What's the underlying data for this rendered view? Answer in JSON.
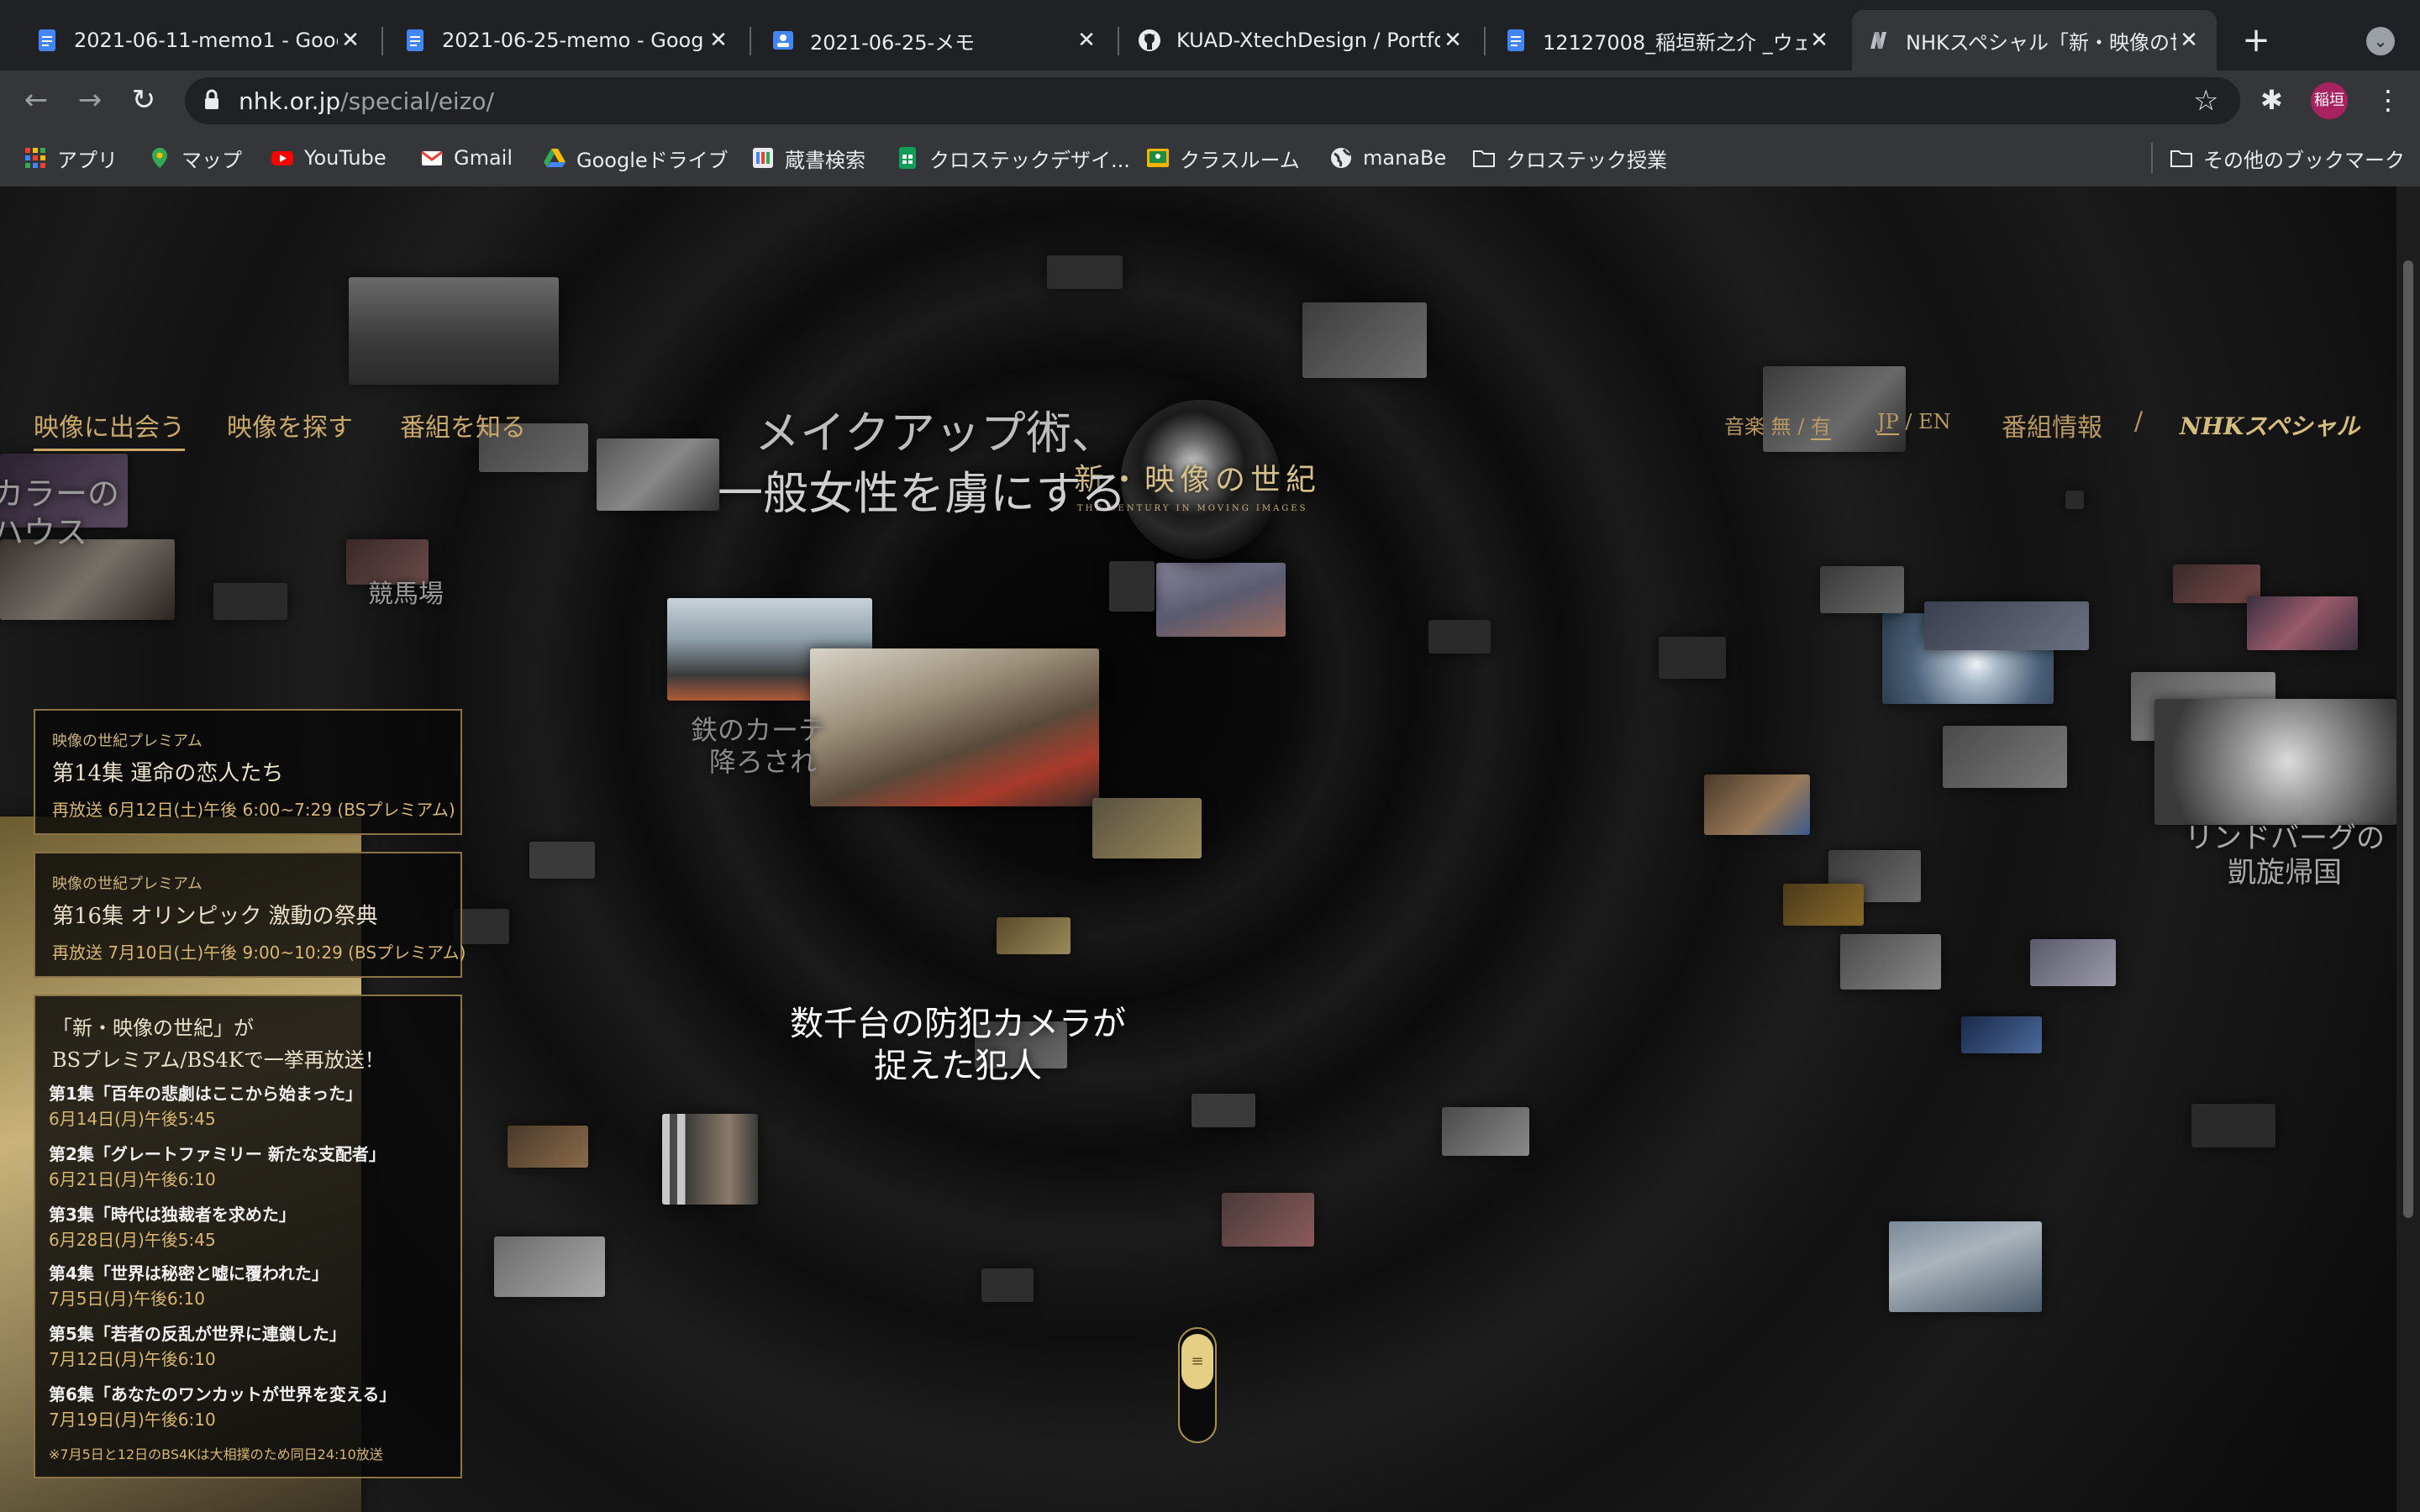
{
  "browser": {
    "tabs": [
      {
        "title": "2021-06-11-memo1 - Goog",
        "icon": "google-docs-icon",
        "active": false
      },
      {
        "title": "2021-06-25-memo - Goog",
        "icon": "google-docs-icon",
        "active": false
      },
      {
        "title": "2021-06-25-メモ",
        "icon": "google-classroom-doc-icon",
        "active": false
      },
      {
        "title": "KUAD-XtechDesign / Portfo",
        "icon": "github-icon",
        "active": false
      },
      {
        "title": "12127008_稲垣新之介 _ウェ",
        "icon": "google-docs-icon",
        "active": false
      },
      {
        "title": "NHKスペシャル「新・映像の世",
        "icon": "nhk-n-icon",
        "active": true
      }
    ],
    "url_host": "nhk.or.jp",
    "url_path": "/special/eizo/",
    "profile_name": "稲垣",
    "bookmarks": [
      {
        "label": "アプリ",
        "icon": "apps-grid-icon",
        "color": "#e94235"
      },
      {
        "label": "マップ",
        "icon": "maps-pin-icon",
        "color": "#34a853"
      },
      {
        "label": "YouTube",
        "icon": "youtube-icon",
        "color": "#ff0000"
      },
      {
        "label": "Gmail",
        "icon": "gmail-icon",
        "color": "#ea4335"
      },
      {
        "label": "Googleドライブ",
        "icon": "drive-icon",
        "color": "#fbbc04"
      },
      {
        "label": "蔵書検索",
        "icon": "library-icon",
        "color": "#8ab4f8"
      },
      {
        "label": "クロステックデザイ...",
        "icon": "sheets-icon",
        "color": "#0f9d58"
      },
      {
        "label": "クラスルーム",
        "icon": "classroom-icon",
        "color": "#f4b400"
      },
      {
        "label": "manaBe",
        "icon": "globe-icon",
        "color": "#e8eaed"
      },
      {
        "label": "クロステック授業",
        "icon": "folder-icon",
        "color": "#e8eaed"
      }
    ],
    "other_bookmarks": "その他のブックマーク"
  },
  "site": {
    "nav": [
      "映像に出会う",
      "映像を探す",
      "番組を知る"
    ],
    "music_label": "音楽",
    "music_off": "無",
    "music_slash": "/",
    "music_on": "有",
    "lang_jp": "JP",
    "lang_slash": "/",
    "lang_en": "EN",
    "program_info": "番組情報",
    "divider": "/",
    "nhk_special_logo": "NHKスペシャル",
    "logo_title": "新・映像の世紀",
    "logo_sub": "THE CENTURY IN MOVING IMAGES"
  },
  "captions": {
    "top_left_1": "メイクアップ術、",
    "top_left_2": "一般女性を虜にする",
    "edge_1": "カラーの",
    "edge_2": "ハウス",
    "keiba": "競馬場",
    "iron_1": "鉄のカーテ",
    "iron_2": "降ろされ",
    "center_1": "数千台の防犯カメラが",
    "center_2": "捉えた犯人",
    "lindbergh_1": "リンドバーグの",
    "lindbergh_2": "凱旋帰国"
  },
  "premium": [
    {
      "label": "映像の世紀プレミアム",
      "title": "第14集 運命の恋人たち",
      "air": "再放送 6月12日(土)午後 6:00~7:29 (BSプレミアム)"
    },
    {
      "label": "映像の世紀プレミアム",
      "title": "第16集 オリンピック 激動の祭典",
      "air": "再放送 7月10日(土)午後 9:00~10:29 (BSプレミアム)"
    }
  ],
  "rerun": {
    "heading_1": "「新・映像の世紀」が",
    "heading_2": "BSプレミアム/BS4Kで一挙再放送！",
    "episodes": [
      {
        "title": "第1集「百年の悲劇はここから始まった」",
        "air": "6月14日(月)午後5:45"
      },
      {
        "title": "第2集「グレートファミリー 新たな支配者」",
        "air": "6月21日(月)午後6:10"
      },
      {
        "title": "第3集「時代は独裁者を求めた」",
        "air": "6月28日(月)午後5:45"
      },
      {
        "title": "第4集「世界は秘密と嘘に覆われた」",
        "air": "7月5日(月)午後6:10"
      },
      {
        "title": "第5集「若者の反乱が世界に連鎖した」",
        "air": "7月12日(月)午後6:10"
      },
      {
        "title": "第6集「あなたのワンカットが世界を変える」",
        "air": "7月19日(月)午後6:10"
      }
    ],
    "note": "※7月5日と12日のBS4Kは大相撲のため同日24:10放送"
  },
  "slider_icon": "menu-lines-icon",
  "colors": {
    "accent_gold": "#c9a86a",
    "chrome_dark": "#202124",
    "chrome_mid": "#35363a"
  }
}
